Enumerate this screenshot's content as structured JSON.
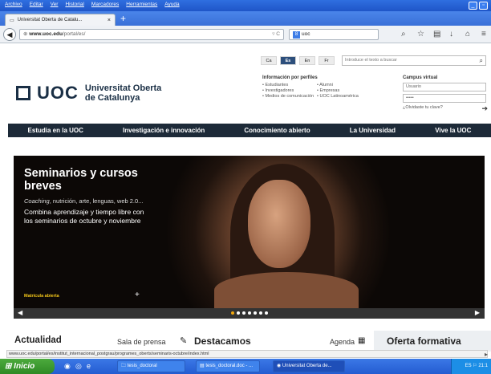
{
  "menu": [
    "Archivo",
    "Editar",
    "Ver",
    "Historial",
    "Marcadores",
    "Herramientas",
    "Ayuda"
  ],
  "tab": {
    "title": "Universitat Oberta de Catalu...",
    "close": "×"
  },
  "newtab": "+",
  "url": {
    "host": "www.uoc.edu",
    "path": "/portal/es/"
  },
  "search": {
    "value": "uoc"
  },
  "langs": [
    {
      "label": "Ca",
      "active": false
    },
    {
      "label": "Es",
      "active": true
    },
    {
      "label": "En",
      "active": false
    },
    {
      "label": "Fr",
      "active": false
    }
  ],
  "site_search_placeholder": "Introduce el texto a buscar",
  "logo": {
    "text": "UOC",
    "line1": "Universitat Oberta",
    "line2": "de Catalunya"
  },
  "profiles": {
    "heading": "Información por perfiles",
    "items": [
      "Estudiantes",
      "Alumni",
      "Investigadores",
      "Empresas",
      "Medios de comunicación",
      "UOC Latinoamérica"
    ]
  },
  "campus": {
    "heading": "Campus virtual",
    "user_placeholder": "Usuario",
    "password_mask": "•••••",
    "forgot": "¿Olvidaste tu clave?"
  },
  "mainnav": [
    "Estudia en la UOC",
    "Investigación e innovación",
    "Conocimiento abierto",
    "La Universidad",
    "Vive la UOC"
  ],
  "hero": {
    "title": "Seminarios y cursos breves",
    "sub_em": "Coaching",
    "sub_rest": ", nutrición, arte, lenguas, web 2.0...",
    "body": "Combina aprendizaje y tiempo libre con los seminarios de octubre y noviembre",
    "cta": "Matrícula abierta",
    "plus": "+",
    "dots": 7,
    "active_dot": 0
  },
  "bottom": {
    "actualidad": "Actualidad",
    "sala": "Sala de prensa",
    "destacamos": "Destacamos",
    "agenda": "Agenda",
    "oferta": "Oferta formativa"
  },
  "status": "www.uoc.edu/portal/es/institut_internacional_postgrau/programes_oberts/seminaris-octubre/index.html",
  "taskbar": {
    "start": "Inicio",
    "tasks": [
      "tesis_doctoral",
      "tesis_doctoral.doc - ...",
      "Universitat Oberta de..."
    ],
    "lang": "ES",
    "clock": "21:1"
  }
}
